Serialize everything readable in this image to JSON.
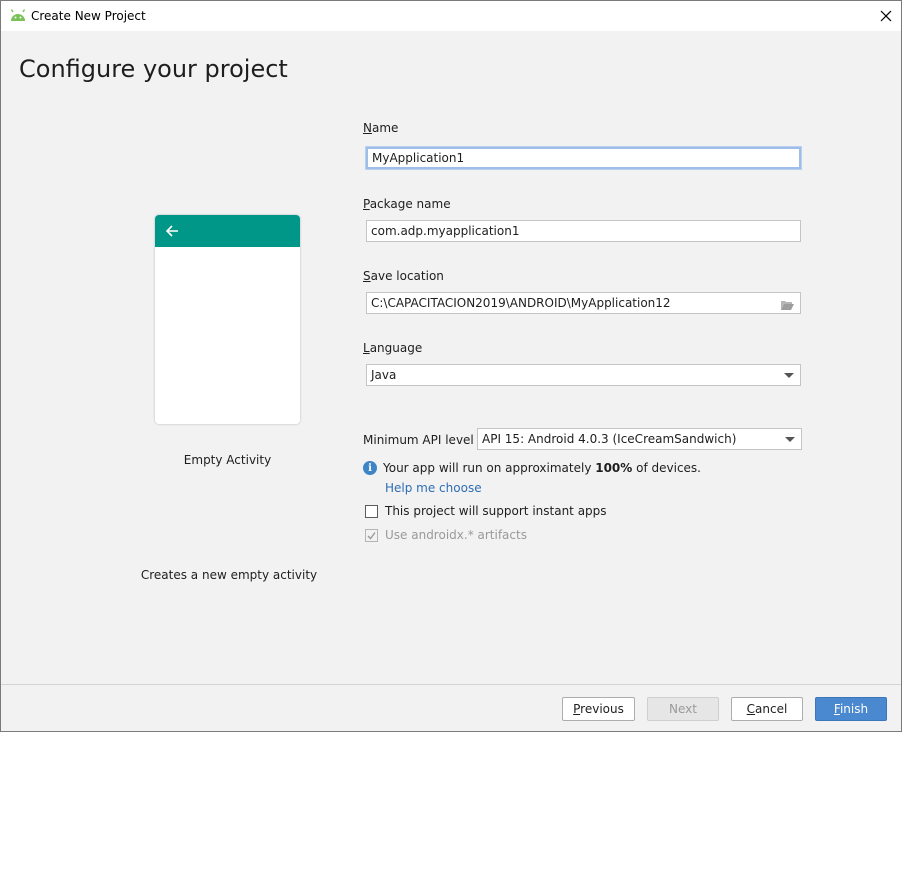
{
  "window": {
    "title": "Create New Project"
  },
  "page": {
    "heading": "Configure your project"
  },
  "template": {
    "name": "Empty Activity",
    "description": "Creates a new empty activity",
    "appbar_color": "#009688"
  },
  "form": {
    "name": {
      "label_mnemonic": "N",
      "label_rest": "ame",
      "value": "MyApplication1"
    },
    "package": {
      "label_mnemonic": "P",
      "label_rest": "ackage name",
      "value": "com.adp.myapplication1"
    },
    "save_location": {
      "label_mnemonic": "S",
      "label_rest": "ave location",
      "value": "C:\\CAPACITACION2019\\ANDROID\\MyApplication12"
    },
    "language": {
      "label_mnemonic": "L",
      "label_rest": "anguage",
      "value": "Java"
    },
    "min_api": {
      "label": "Minimum API level",
      "value": "API 15: Android 4.0.3 (IceCreamSandwich)"
    }
  },
  "info": {
    "text_before": "Your app will run on approximately ",
    "percent": "100%",
    "text_after": " of devices.",
    "help_link": "Help me choose"
  },
  "options": {
    "instant_apps": {
      "label": "This project will support instant apps",
      "checked": false
    },
    "androidx": {
      "label": "Use androidx.* artifacts",
      "checked": true,
      "disabled": true
    }
  },
  "buttons": {
    "previous_mn": "P",
    "previous_rest": "revious",
    "next": "Next",
    "cancel_mn": "C",
    "cancel_rest": "ancel",
    "finish_mn": "F",
    "finish_rest": "inish"
  },
  "colors": {
    "accent": "#4a88cf",
    "link": "#2f6db5",
    "info": "#3d85c6"
  }
}
